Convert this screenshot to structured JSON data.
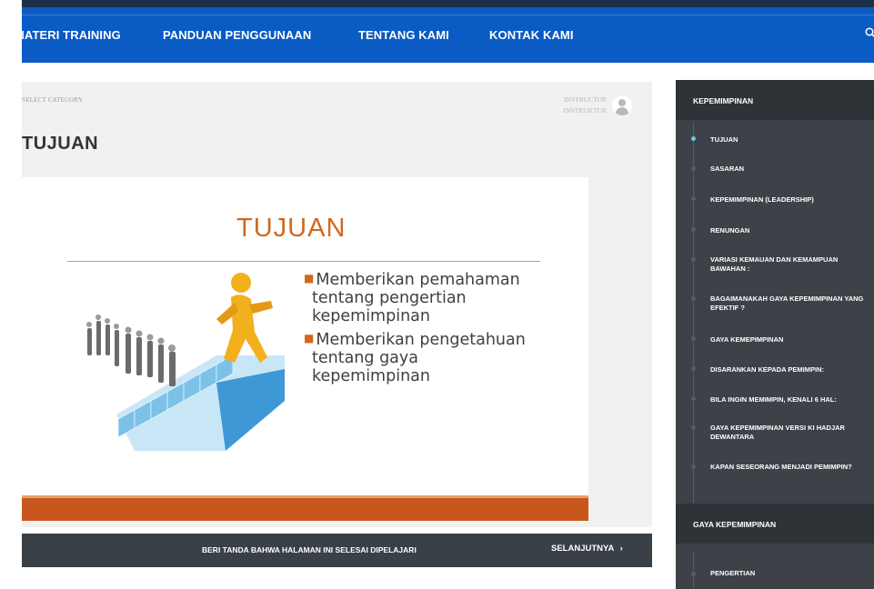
{
  "nav": {
    "items": [
      "MATERI TRAINING",
      "PANDUAN PENGGUNAAN",
      "TENTANG KAMI",
      "KONTAK KAMI"
    ],
    "search_icon": "search-icon"
  },
  "content": {
    "category": "SELECT CATEGORY",
    "instructor_label": "INSTRUCTOR",
    "instructor_name": "INSTRUKTUR",
    "title": "TUJUAN"
  },
  "slide": {
    "title": "TUJUAN",
    "bullets": [
      [
        "Memberikan pemahaman",
        "tentang pengertian",
        "kepemimpinan"
      ],
      [
        "Memberikan pengetahuan",
        "tentang gaya",
        "kepemimpinan"
      ]
    ],
    "accent": "#d0691e"
  },
  "footer": {
    "mark_complete": "BERI TANDA BAHWA HALAMAN INI SELESAI DIPELAJARI",
    "next": "SELANJUTNYA"
  },
  "sidebar": {
    "sections": [
      {
        "title": "KEPEMIMPINAN",
        "lessons": [
          "TUJUAN",
          "SASARAN",
          "KEPEMIMPINAN (LEADERSHIP)",
          "RENUNGAN",
          "VARIASI KEMAUAN DAN KEMAMPUAN BAWAHAN :",
          "BAGAIMANAKAH GAYA KEPEMIMPINAN YANG EFEKTIF ?",
          "GAYA KEMEPIMPINAN",
          "DISARANKAN KEPADA PEMIMPIN:",
          "BILA INGIN MEMIMPIN, KENALI 6 HAL:",
          "GAYA KEPEMIMPINAN VERSI KI HADJAR DEWANTARA",
          "KAPAN SESEORANG MENJADI PEMIMPIN?"
        ]
      },
      {
        "title": "GAYA KEPEMIMPINAN",
        "lessons": [
          "PENGERTIAN"
        ]
      }
    ],
    "active_color": "#6ec7e8"
  }
}
